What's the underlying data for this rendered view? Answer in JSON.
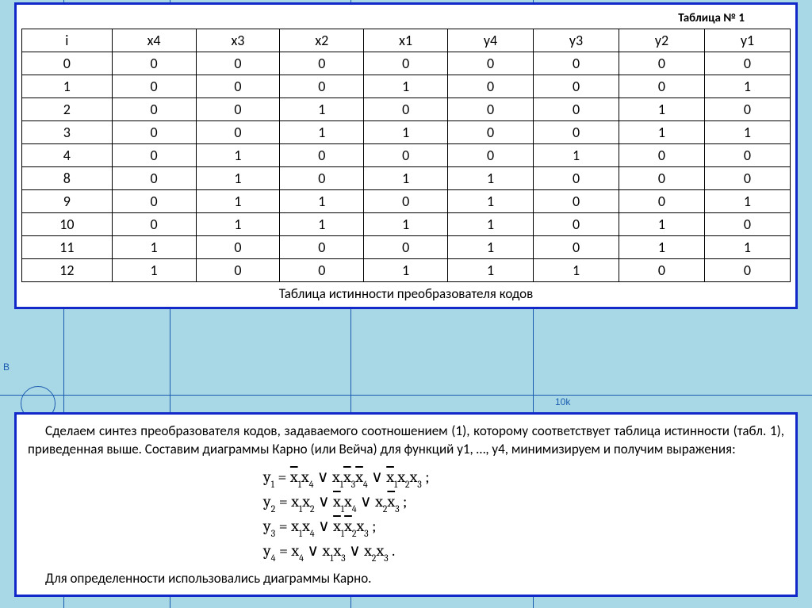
{
  "table": {
    "title": "Таблица № 1",
    "headers": [
      "i",
      "x4",
      "x3",
      "x2",
      "x1",
      "y4",
      "y3",
      "y2",
      "y1"
    ],
    "rows": [
      [
        "0",
        "0",
        "0",
        "0",
        "0",
        "0",
        "0",
        "0",
        "0"
      ],
      [
        "1",
        "0",
        "0",
        "0",
        "1",
        "0",
        "0",
        "0",
        "1"
      ],
      [
        "2",
        "0",
        "0",
        "1",
        "0",
        "0",
        "0",
        "1",
        "0"
      ],
      [
        "3",
        "0",
        "0",
        "1",
        "1",
        "0",
        "0",
        "1",
        "1"
      ],
      [
        "4",
        "0",
        "1",
        "0",
        "0",
        "0",
        "1",
        "0",
        "0"
      ],
      [
        "8",
        "0",
        "1",
        "0",
        "1",
        "1",
        "0",
        "0",
        "0"
      ],
      [
        "9",
        "0",
        "1",
        "1",
        "0",
        "1",
        "0",
        "0",
        "1"
      ],
      [
        "10",
        "0",
        "1",
        "1",
        "1",
        "1",
        "0",
        "1",
        "0"
      ],
      [
        "11",
        "1",
        "0",
        "0",
        "0",
        "1",
        "0",
        "1",
        "1"
      ],
      [
        "12",
        "1",
        "0",
        "0",
        "1",
        "1",
        "1",
        "0",
        "0"
      ]
    ],
    "caption": "Таблица истинности преобразователя кодов"
  },
  "text": {
    "p1_a": "Сделаем синтез преобразователя кодов, задаваемого соотношением (1), которому соответствует таблица истинности (табл. 1), приведенная выше. Составим диаграммы Карно (или Вейча) для функций y1, …, y4, минимизируем и получим выражения:",
    "p2": "Для определенности использовались диаграммы Карно."
  },
  "bg": {
    "b_label": "B",
    "res_label": "10k"
  },
  "chart_data": {
    "type": "table",
    "title": "Таблица № 1 — Таблица истинности преобразователя кодов",
    "columns": [
      "i",
      "x4",
      "x3",
      "x2",
      "x1",
      "y4",
      "y3",
      "y2",
      "y1"
    ],
    "rows": [
      [
        0,
        0,
        0,
        0,
        0,
        0,
        0,
        0,
        0
      ],
      [
        1,
        0,
        0,
        0,
        1,
        0,
        0,
        0,
        1
      ],
      [
        2,
        0,
        0,
        1,
        0,
        0,
        0,
        1,
        0
      ],
      [
        3,
        0,
        0,
        1,
        1,
        0,
        0,
        1,
        1
      ],
      [
        4,
        0,
        1,
        0,
        0,
        0,
        1,
        0,
        0
      ],
      [
        8,
        0,
        1,
        0,
        1,
        1,
        0,
        0,
        0
      ],
      [
        9,
        0,
        1,
        1,
        0,
        1,
        0,
        0,
        1
      ],
      [
        10,
        0,
        1,
        1,
        1,
        1,
        0,
        1,
        0
      ],
      [
        11,
        1,
        0,
        0,
        0,
        1,
        0,
        1,
        1
      ],
      [
        12,
        1,
        0,
        0,
        1,
        1,
        1,
        0,
        0
      ]
    ]
  }
}
